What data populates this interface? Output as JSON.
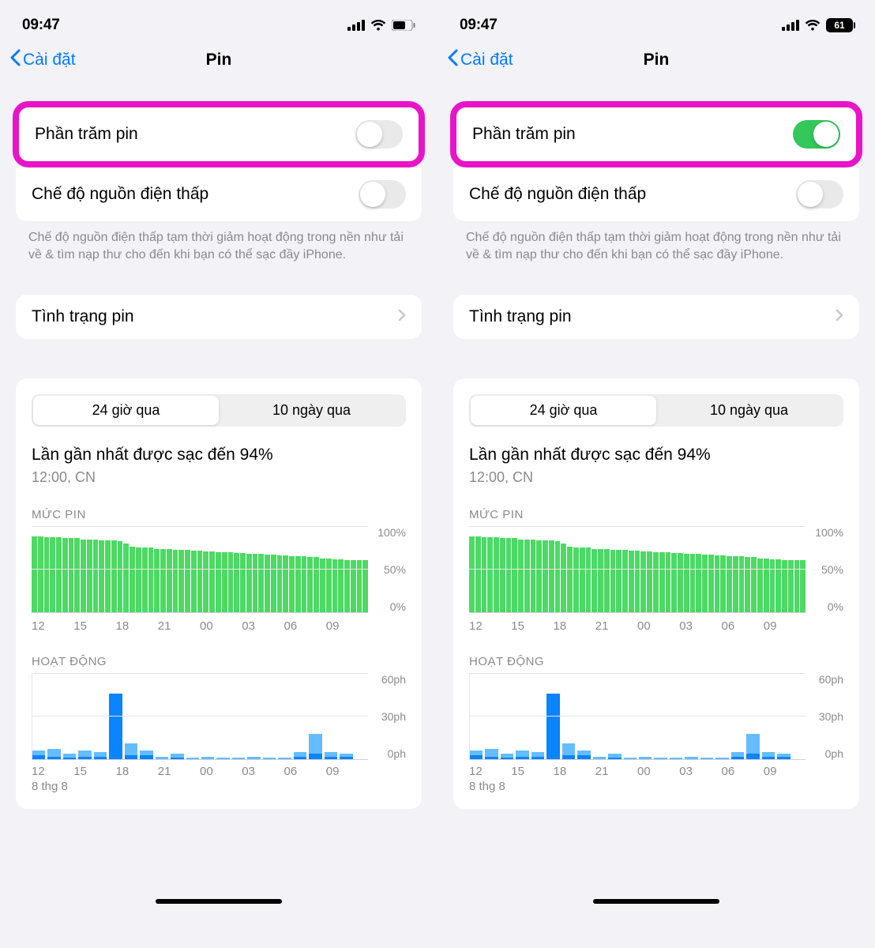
{
  "status_time": "09:47",
  "batt_percent_label": "61",
  "nav": {
    "back": "Cài đặt",
    "title": "Pin"
  },
  "settings": {
    "battery_percent": "Phần trăm pin",
    "low_power": "Chế độ nguồn điện thấp",
    "low_power_footer": "Chế độ nguồn điện thấp tạm thời giảm hoạt động trong nền như tải về & tìm nạp thư cho đến khi bạn có thể sạc đầy iPhone.",
    "battery_health": "Tình trạng pin"
  },
  "seg": {
    "tab1": "24 giờ qua",
    "tab2": "10 ngày qua"
  },
  "charge": {
    "title": "Lần gần nhất được sạc đến 94%",
    "sub": "12:00, CN"
  },
  "level_section_label": "MỨC PIN",
  "activity_section_label": "HOẠT ĐỘNG",
  "xaxis_hours": [
    "12",
    "15",
    "18",
    "21",
    "00",
    "03",
    "06",
    "09"
  ],
  "date_label": "8 thg 8",
  "level_yaxis": [
    "100%",
    "50%",
    "0%"
  ],
  "activity_yaxis": [
    "60ph",
    "30ph",
    "0ph"
  ],
  "chart_data": {
    "level": {
      "type": "bar",
      "ylim": [
        0,
        100
      ],
      "xlabel_hours": [
        "12",
        "15",
        "18",
        "21",
        "00",
        "03",
        "06",
        "09"
      ],
      "values": [
        88,
        88,
        87,
        87,
        87,
        86,
        86,
        86,
        85,
        85,
        85,
        84,
        84,
        84,
        83,
        80,
        76,
        75,
        75,
        75,
        74,
        74,
        74,
        73,
        73,
        73,
        72,
        72,
        71,
        71,
        70,
        70,
        70,
        69,
        69,
        68,
        68,
        68,
        67,
        67,
        66,
        66,
        65,
        65,
        65,
        64,
        64,
        63,
        63,
        62,
        62,
        61,
        61,
        61,
        61
      ]
    },
    "activity": {
      "type": "stacked-bar",
      "ylim": [
        0,
        60
      ],
      "unit": "ph",
      "xlabel_hours": [
        "12",
        "15",
        "18",
        "21",
        "00",
        "03",
        "06",
        "09"
      ],
      "series_names": [
        "dark",
        "light"
      ],
      "values": [
        {
          "d": 3,
          "l": 3
        },
        {
          "d": 2,
          "l": 5
        },
        {
          "d": 1,
          "l": 3
        },
        {
          "d": 2,
          "l": 4
        },
        {
          "d": 2,
          "l": 3
        },
        {
          "d": 46,
          "l": 0
        },
        {
          "d": 3,
          "l": 8
        },
        {
          "d": 3,
          "l": 3
        },
        {
          "d": 0,
          "l": 2
        },
        {
          "d": 1,
          "l": 3
        },
        {
          "d": 0,
          "l": 1
        },
        {
          "d": 0,
          "l": 2
        },
        {
          "d": 0,
          "l": 1
        },
        {
          "d": 0,
          "l": 1
        },
        {
          "d": 0,
          "l": 2
        },
        {
          "d": 0,
          "l": 1
        },
        {
          "d": 0,
          "l": 1
        },
        {
          "d": 2,
          "l": 3
        },
        {
          "d": 4,
          "l": 14
        },
        {
          "d": 2,
          "l": 3
        },
        {
          "d": 2,
          "l": 2
        },
        {
          "d": 0,
          "l": 0
        }
      ]
    }
  }
}
